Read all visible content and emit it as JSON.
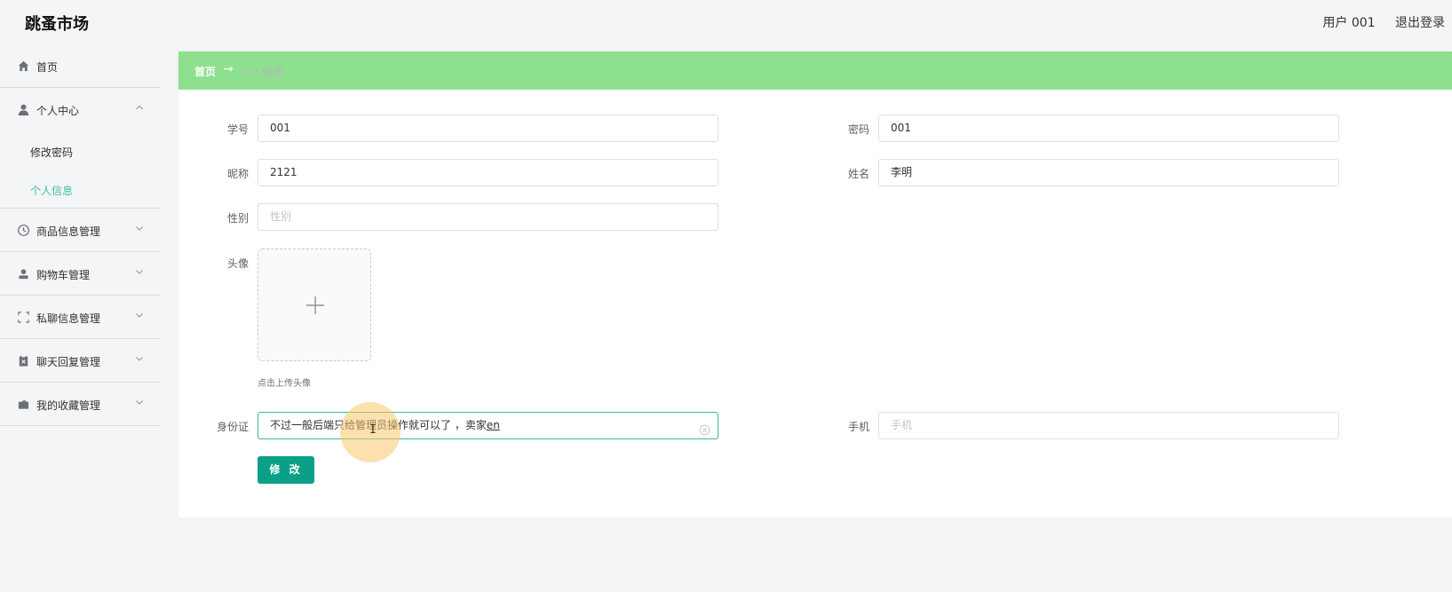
{
  "header": {
    "brand": "跳蚤市场",
    "user": "用户 001",
    "logout": "退出登录"
  },
  "sidebar": {
    "items": [
      {
        "label": "首页",
        "icon": "home-icon"
      },
      {
        "label": "个人中心",
        "icon": "user-icon",
        "expanded": true,
        "children": [
          {
            "label": "修改密码"
          },
          {
            "label": "个人信息",
            "active": true
          }
        ]
      },
      {
        "label": "商品信息管理",
        "icon": "clock-icon"
      },
      {
        "label": "购物车管理",
        "icon": "person-icon"
      },
      {
        "label": "私聊信息管理",
        "icon": "frame-icon"
      },
      {
        "label": "聊天回复管理",
        "icon": "clipboard-icon"
      },
      {
        "label": "我的收藏管理",
        "icon": "folder-icon"
      }
    ]
  },
  "breadcrumb": {
    "home": "首页",
    "separator": "→",
    "current": "个人信息"
  },
  "form": {
    "student_id": {
      "label": "学号",
      "value": "001"
    },
    "password": {
      "label": "密码",
      "value": "001"
    },
    "nickname": {
      "label": "昵称",
      "value": "2121"
    },
    "name": {
      "label": "姓名",
      "value": "李明"
    },
    "gender": {
      "label": "性别",
      "placeholder": "性别"
    },
    "avatar": {
      "label": "头像",
      "tip": "点击上传头像"
    },
    "id_card": {
      "label": "身份证",
      "value": "不过一般后端只给管理员操作就可以了 ，卖家",
      "composing": "en"
    },
    "phone": {
      "label": "手机",
      "placeholder": "手机"
    },
    "submit": "修 改"
  },
  "colors": {
    "accent": "#3fc1a3",
    "button": "#0aa088",
    "breadcrumb_bg": "#8de08d"
  }
}
